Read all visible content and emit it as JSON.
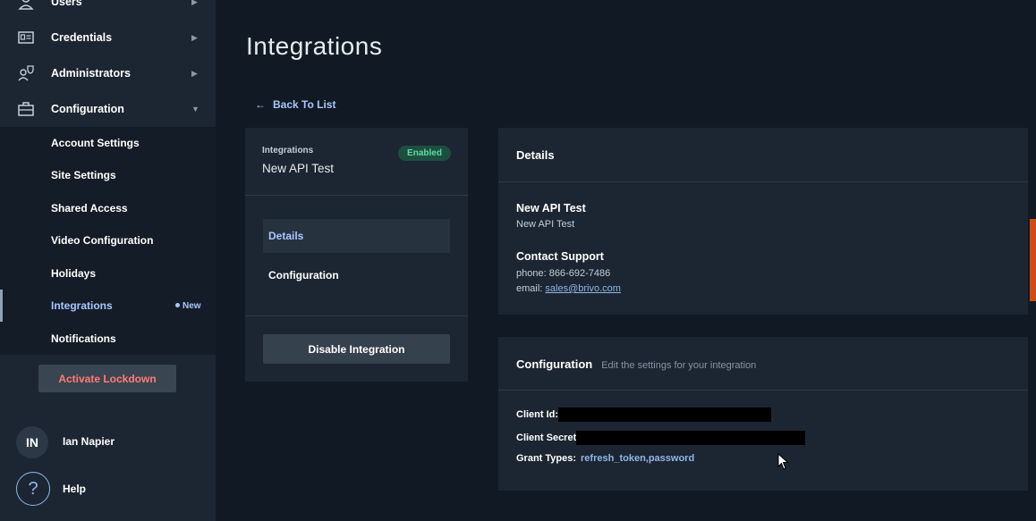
{
  "sidebar": {
    "nav": [
      {
        "label": "Users",
        "icon": "user-icon"
      },
      {
        "label": "Credentials",
        "icon": "id-card-icon"
      },
      {
        "label": "Administrators",
        "icon": "admin-icon"
      },
      {
        "label": "Configuration",
        "icon": "briefcase-icon"
      }
    ],
    "sub_items": [
      {
        "label": "Account Settings"
      },
      {
        "label": "Site Settings"
      },
      {
        "label": "Shared Access"
      },
      {
        "label": "Video Configuration"
      },
      {
        "label": "Holidays"
      },
      {
        "label": "Integrations",
        "badge": "New"
      },
      {
        "label": "Notifications"
      }
    ],
    "lockdown_label": "Activate Lockdown",
    "user": {
      "initials": "IN",
      "name": "Ian Napier"
    },
    "help": {
      "icon_text": "?",
      "label": "Help"
    }
  },
  "main": {
    "title": "Integrations",
    "back_link": "Back To List",
    "back_arrow": "←",
    "integration": {
      "kicker": "Integrations",
      "name": "New API Test",
      "status": "Enabled",
      "tabs": [
        {
          "label": "Details"
        },
        {
          "label": "Configuration"
        }
      ],
      "disable_label": "Disable Integration"
    },
    "details": {
      "header": "Details",
      "name": "New API Test",
      "description": "New API Test",
      "support_title": "Contact Support",
      "phone": "phone: 866-692-7486",
      "email_prefix": "email: ",
      "email": "sales@brivo.com"
    },
    "configuration": {
      "header": "Configuration",
      "subheader": "Edit the settings for your integration",
      "client_id_label": "Client Id:",
      "client_secret_label": "Client Secret",
      "grant_types_label": "Grant Types:",
      "grant_types_value": "refresh_token,password"
    }
  }
}
